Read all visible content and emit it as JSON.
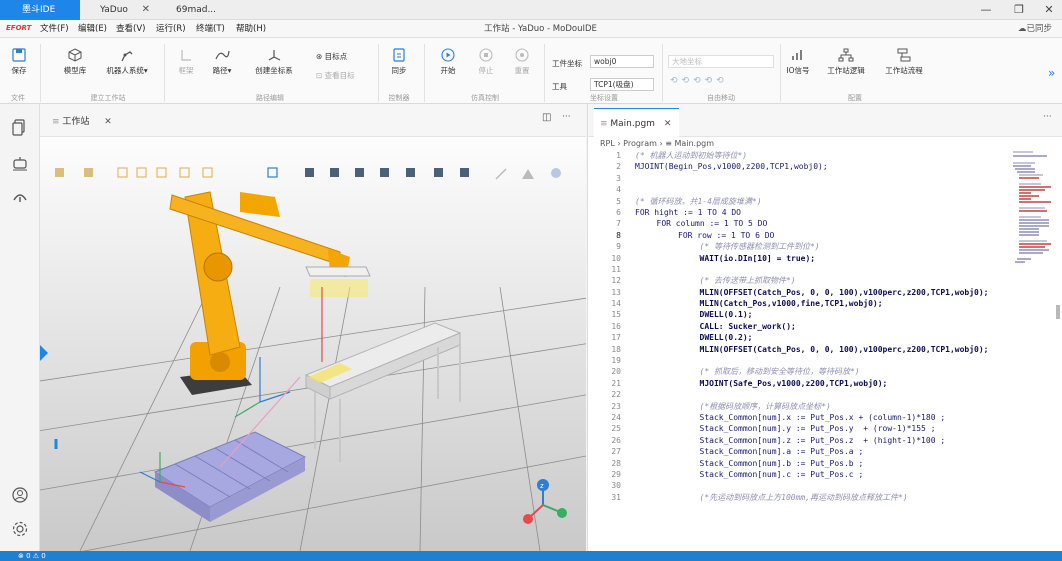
{
  "titlebar": {
    "tabs": [
      {
        "label": "墨斗IDE",
        "active": true
      },
      {
        "label": "YaDuo",
        "active": false,
        "closable": true
      },
      {
        "label": "69mad...",
        "active": false
      }
    ],
    "window_controls": {
      "minimize": "—",
      "restore": "❐",
      "close": "✕"
    }
  },
  "menubar": {
    "brand": "EFORT",
    "items": [
      "文件(F)",
      "编辑(E)",
      "查看(V)",
      "运行(R)",
      "终端(T)",
      "帮助(H)"
    ],
    "window_title": "工作站 - YaDuo - MoDouIDE",
    "sync_status": "已同步"
  },
  "ribbon": {
    "file_group": {
      "save_label": "保存",
      "group_label": "文件"
    },
    "build_group": {
      "model_lib": "模型库",
      "robot_system": "机器人系统▾",
      "group_label": "建立工作站"
    },
    "path_group": {
      "frame": "框架",
      "path": "路径▾",
      "create_coord": "创建坐标系",
      "target_point": "目标点",
      "view_target": "查看目标",
      "group_label": "路径编辑"
    },
    "controller_group": {
      "sync": "同步",
      "group_label": "控制器"
    },
    "sim_group": {
      "start": "开始",
      "stop": "停止",
      "reset": "重置",
      "group_label": "仿真控制"
    },
    "coord_group": {
      "wobj_label": "工件坐标",
      "wobj_value": "wobj0",
      "tool_label": "工具",
      "tool_value": "TCP1(吸盘)",
      "group_label": "坐标设置"
    },
    "jog_group": {
      "coord_label": "大地坐标",
      "group_label": "自由移动"
    },
    "config_group": {
      "io": "IO信号",
      "logic": "工作站逻辑",
      "flow": "工作站流程",
      "group_label": "配置"
    }
  },
  "workstation": {
    "tab_label": "工作站",
    "toolbar_more": "···"
  },
  "editor": {
    "tab_label": "Main.pgm",
    "breadcrumb": [
      "RPL",
      "Program",
      "Main.pgm"
    ],
    "more": "···",
    "current_line": 8,
    "lines": [
      {
        "n": "1",
        "text": "(* 机器人运动到初始等待位*)",
        "style": "cm",
        "indent": 0
      },
      {
        "n": "2",
        "text": "MJOINT(Begin_Pos,v1000,z200,TCP1,wobj0);",
        "style": "kw",
        "indent": 0
      },
      {
        "n": "3",
        "text": "",
        "style": "kw",
        "indent": 0
      },
      {
        "n": "4",
        "text": "",
        "style": "kw",
        "indent": 0
      },
      {
        "n": "5",
        "text": "(* 循环码放，共1-4层成旋堆满*)",
        "style": "cm",
        "indent": 0
      },
      {
        "n": "6",
        "text": "FOR hight := 1 TO 4 DO",
        "style": "kw",
        "indent": 0
      },
      {
        "n": "7",
        "text": "FOR column := 1 TO 5 DO",
        "style": "kw",
        "indent": 1
      },
      {
        "n": "8",
        "text": "FOR row := 1 TO 6 DO",
        "style": "kw",
        "indent": 2
      },
      {
        "n": "9",
        "text": "(* 等待传感器检测到工件到位*)",
        "style": "cm",
        "indent": 3
      },
      {
        "n": "10",
        "text": "WAIT(io.DIn[10] = true);",
        "style": "bold",
        "indent": 3
      },
      {
        "n": "11",
        "text": "",
        "style": "kw",
        "indent": 0
      },
      {
        "n": "12",
        "text": "(* 去传送带上抓取物件*)",
        "style": "cm",
        "indent": 3
      },
      {
        "n": "13",
        "text": "MLIN(OFFSET(Catch_Pos, 0, 0, 100),v100perc,z200,TCP1,wobj0);",
        "style": "bold",
        "indent": 3
      },
      {
        "n": "14",
        "text": "MLIN(Catch_Pos,v1000,fine,TCP1,wobj0);",
        "style": "bold",
        "indent": 3
      },
      {
        "n": "15",
        "text": "DWELL(0.1);",
        "style": "bold",
        "indent": 3
      },
      {
        "n": "16",
        "text": "CALL: Sucker_work();",
        "style": "bold",
        "indent": 3
      },
      {
        "n": "17",
        "text": "DWELL(0.2);",
        "style": "bold",
        "indent": 3
      },
      {
        "n": "18",
        "text": "MLIN(OFFSET(Catch_Pos, 0, 0, 100),v100perc,z200,TCP1,wobj0);",
        "style": "bold",
        "indent": 3
      },
      {
        "n": "19",
        "text": "",
        "style": "kw",
        "indent": 0
      },
      {
        "n": "20",
        "text": "(* 抓取后，移动到安全等待位，等待码放*)",
        "style": "cm",
        "indent": 3
      },
      {
        "n": "21",
        "text": "MJOINT(Safe_Pos,v1000,z200,TCP1,wobj0);",
        "style": "bold",
        "indent": 3
      },
      {
        "n": "22",
        "text": "",
        "style": "kw",
        "indent": 0
      },
      {
        "n": "23",
        "text": "(*根据码放顺序，计算码放点坐标*)",
        "style": "cm",
        "indent": 3
      },
      {
        "n": "24",
        "text": "Stack_Common[num].x := Put_Pos.x + (column-1)*180 ;",
        "style": "kw",
        "indent": 3
      },
      {
        "n": "25",
        "text": "Stack_Common[num].y := Put_Pos.y  + (row-1)*155 ;",
        "style": "kw",
        "indent": 3
      },
      {
        "n": "26",
        "text": "Stack_Common[num].z := Put_Pos.z  + (hight-1)*100 ;",
        "style": "kw",
        "indent": 3
      },
      {
        "n": "27",
        "text": "Stack_Common[num].a := Put_Pos.a ;",
        "style": "kw",
        "indent": 3
      },
      {
        "n": "28",
        "text": "Stack_Common[num].b := Put_Pos.b ;",
        "style": "kw",
        "indent": 3
      },
      {
        "n": "29",
        "text": "Stack_Common[num].c := Put_Pos.c ;",
        "style": "kw",
        "indent": 3
      },
      {
        "n": "30",
        "text": "",
        "style": "kw",
        "indent": 0
      },
      {
        "n": "31",
        "text": "(*先运动到码放点上方100mm,再运动到码放点释放工件*)",
        "style": "cm",
        "indent": 3
      }
    ]
  },
  "statusbar": {
    "text": "⊗ 0 ⚠ 0"
  },
  "colors": {
    "accent": "#1d86e8",
    "robot": "#f5a300",
    "pallet": "#a8a8e0",
    "grid": "#9a9a9a"
  }
}
